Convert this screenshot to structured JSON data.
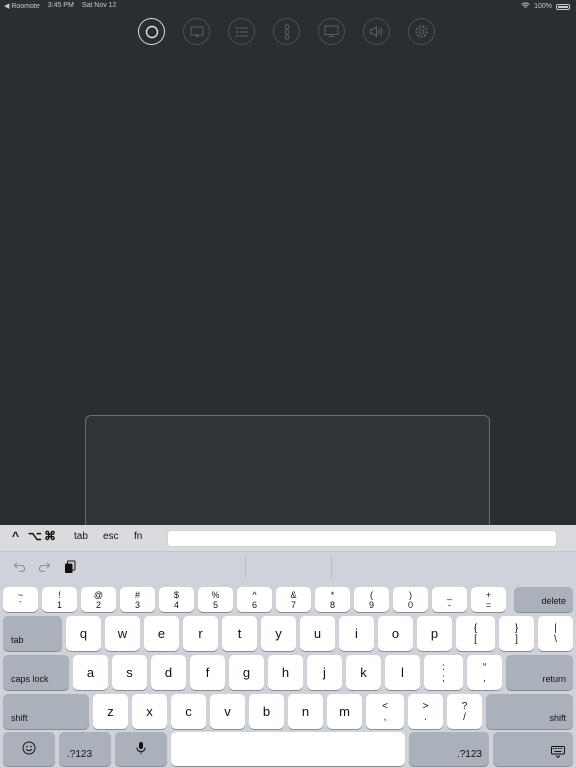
{
  "status_bar": {
    "back_app": "◀ Roomote",
    "time": "3:45 PM",
    "date": "Sat Nov 12",
    "battery": "100%"
  },
  "toolbar": {
    "buttons": [
      {
        "name": "remote",
        "icon": "circle-icon",
        "active": true
      },
      {
        "name": "airplay",
        "icon": "airplay-icon",
        "active": false
      },
      {
        "name": "list",
        "icon": "list-icon",
        "active": false
      },
      {
        "name": "more",
        "icon": "more-vertical-icon",
        "active": false
      },
      {
        "name": "display",
        "icon": "monitor-icon",
        "active": false
      },
      {
        "name": "volume",
        "icon": "speaker-icon",
        "active": false
      },
      {
        "name": "settings",
        "icon": "gear-icon",
        "active": false
      }
    ]
  },
  "accessory": {
    "ctrl": "^",
    "option": "⌥",
    "command": "⌘",
    "tab": "tab",
    "esc": "esc",
    "fn": "fn",
    "input_value": ""
  },
  "keyboard": {
    "number_row": [
      {
        "top": "~",
        "bottom": "`"
      },
      {
        "top": "!",
        "bottom": "1"
      },
      {
        "top": "@",
        "bottom": "2"
      },
      {
        "top": "#",
        "bottom": "3"
      },
      {
        "top": "$",
        "bottom": "4"
      },
      {
        "top": "%",
        "bottom": "5"
      },
      {
        "top": "^",
        "bottom": "6"
      },
      {
        "top": "&",
        "bottom": "7"
      },
      {
        "top": "*",
        "bottom": "8"
      },
      {
        "top": "(",
        "bottom": "9"
      },
      {
        "top": ")",
        "bottom": "0"
      },
      {
        "top": "_",
        "bottom": "-"
      },
      {
        "top": "+",
        "bottom": "="
      }
    ],
    "delete": "delete",
    "tab": "tab",
    "row_q": [
      "q",
      "w",
      "e",
      "r",
      "t",
      "y",
      "u",
      "i",
      "o",
      "p"
    ],
    "brace": {
      "top": "{",
      "bottom": "["
    },
    "brace_close": {
      "top": "}",
      "bottom": "]"
    },
    "pipe": {
      "top": "|",
      "bottom": "\\"
    },
    "caps_lock": "caps lock",
    "row_a": [
      "a",
      "s",
      "d",
      "f",
      "g",
      "h",
      "j",
      "k",
      "l"
    ],
    "colon": {
      "top": ":",
      "bottom": ";"
    },
    "quote": {
      "top": "“",
      "bottom": ","
    },
    "return": "return",
    "shift": "shift",
    "row_z": [
      "z",
      "x",
      "c",
      "v",
      "b",
      "n",
      "m"
    ],
    "lt": {
      "top": "<",
      "bottom": ","
    },
    "gt": {
      "top": ">",
      "bottom": "."
    },
    "question": {
      "top": "?",
      "bottom": "/"
    },
    "shift_right": "shift",
    "num_left": ".?123",
    "num_right": ".?123"
  }
}
